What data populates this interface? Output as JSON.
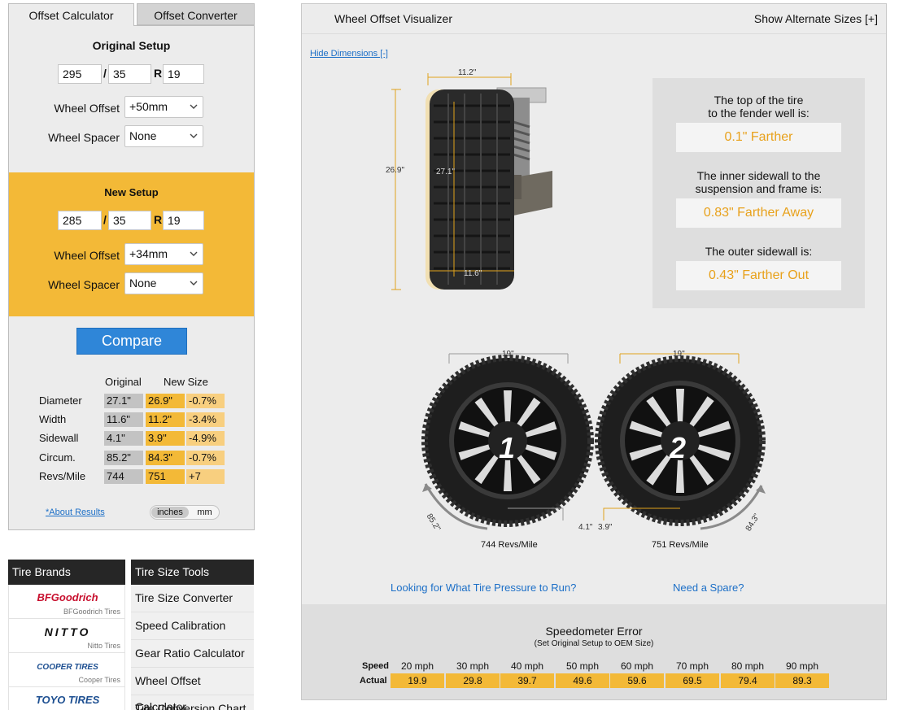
{
  "tabs": {
    "calculator": "Offset Calculator",
    "converter": "Offset Converter"
  },
  "original": {
    "title": "Original Setup",
    "width": "295",
    "sep": "/",
    "aspect": "35",
    "r": "R",
    "rim": "19",
    "offset_label": "Wheel Offset",
    "offset_value": "+50mm",
    "spacer_label": "Wheel Spacer",
    "spacer_value": "None"
  },
  "new_setup": {
    "title": "New Setup",
    "width": "285",
    "sep": "/",
    "aspect": "35",
    "r": "R",
    "rim": "19",
    "offset_label": "Wheel Offset",
    "offset_value": "+34mm",
    "spacer_label": "Wheel Spacer",
    "spacer_value": "None"
  },
  "compare_label": "Compare",
  "results": {
    "header_original": "Original",
    "header_new": "New Size",
    "rows": [
      {
        "label": "Diameter",
        "original": "27.1\"",
        "new": "26.9\"",
        "diff": "-0.7%"
      },
      {
        "label": "Width",
        "original": "11.6\"",
        "new": "11.2\"",
        "diff": "-3.4%"
      },
      {
        "label": "Sidewall",
        "original": "4.1\"",
        "new": "3.9\"",
        "diff": "-4.9%"
      },
      {
        "label": "Circum.",
        "original": "85.2\"",
        "new": "84.3\"",
        "diff": "-0.7%"
      },
      {
        "label": "Revs/Mile",
        "original": "744",
        "new": "751",
        "diff": "+7"
      }
    ],
    "about_link": "*About Results",
    "unit_inches": "inches",
    "unit_mm": "mm"
  },
  "brands": {
    "title": "Tire Brands",
    "items": [
      {
        "logo": "BFGoodrich",
        "name": "BFGoodrich Tires",
        "color": "#c8102e"
      },
      {
        "logo": "NITTO",
        "name": "Nitto Tires",
        "color": "#111111"
      },
      {
        "logo": "COOPER TIRES",
        "name": "Cooper Tires",
        "color": "#1d4f91"
      },
      {
        "logo": "TOYO TIRES",
        "name": "",
        "color": "#1d4f91"
      }
    ]
  },
  "tools": {
    "title": "Tire Size Tools",
    "items": [
      "Tire Size Converter",
      "Speed Calibration",
      "Gear Ratio Calculator",
      "Wheel Offset Calculator",
      "Tire Conversion Chart"
    ]
  },
  "visualizer": {
    "title": "Wheel Offset Visualizer",
    "alt_sizes": "Show Alternate Sizes [+]",
    "hide_dims": "Hide Dimensions [-]",
    "dims": {
      "top_width": "11.2\"",
      "bottom_width": "11.6\"",
      "outer_height": "26.9\"",
      "inner_height": "27.1\""
    },
    "info": [
      {
        "text": "The top of the tire\nto the fender well is:",
        "value": "0.1\" Farther"
      },
      {
        "text": "The inner sidewall to the\nsuspension and frame is:",
        "value": "0.83\" Farther Away"
      },
      {
        "text": "The outer sidewall is:",
        "value": "0.43\" Farther Out"
      }
    ],
    "wheels": {
      "left": {
        "number": "1",
        "rim": "19\"",
        "circum": "85.2\"",
        "sidewall": "4.1\"",
        "revs": "744 Revs/Mile"
      },
      "right": {
        "number": "2",
        "rim": "19\"",
        "circum": "84.3\"",
        "sidewall": "3.9\"",
        "revs": "751 Revs/Mile"
      }
    },
    "pressure_link": "Looking for What Tire Pressure to Run?",
    "spare_link": "Need a Spare?"
  },
  "speedometer": {
    "title": "Speedometer Error",
    "subtitle": "(Set Original Setup to OEM Size)",
    "speed_label": "Speed",
    "actual_label": "Actual",
    "speeds": [
      "20 mph",
      "30 mph",
      "40 mph",
      "50 mph",
      "60 mph",
      "70 mph",
      "80 mph",
      "90 mph"
    ],
    "actual": [
      "19.9",
      "29.8",
      "39.7",
      "49.6",
      "59.6",
      "69.5",
      "79.4",
      "89.3"
    ]
  },
  "colors": {
    "accent": "#f3b937",
    "link": "#1c6fc7",
    "button": "#2f86d8",
    "value_text": "#e8a11b"
  }
}
